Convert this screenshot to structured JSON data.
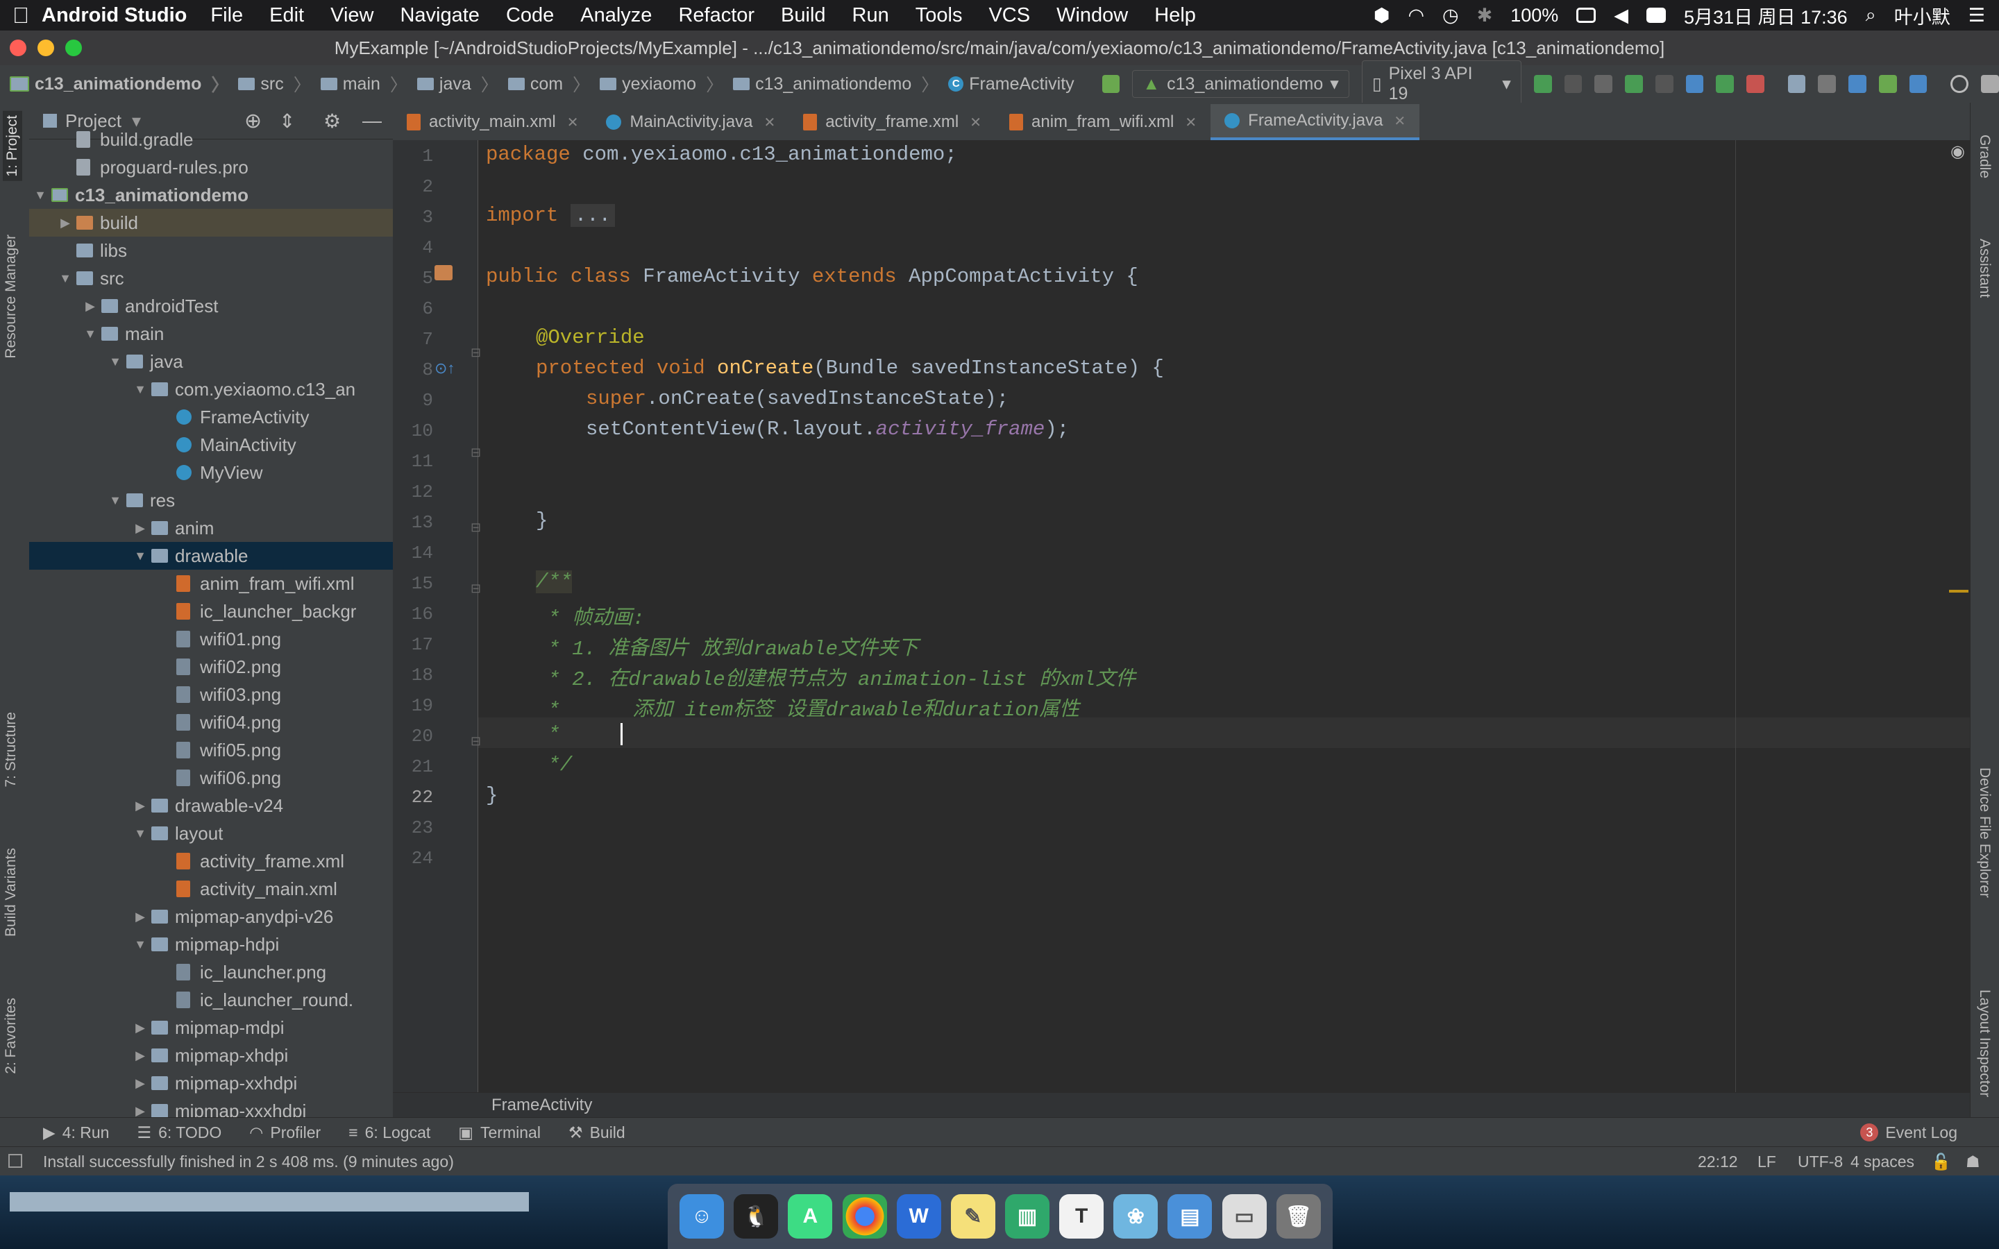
{
  "menubar": {
    "app": "Android Studio",
    "items": [
      "File",
      "Edit",
      "View",
      "Navigate",
      "Code",
      "Analyze",
      "Refactor",
      "Build",
      "Run",
      "Tools",
      "VCS",
      "Window",
      "Help"
    ],
    "battery": "100%",
    "datetime": "5月31日 周日 17:36",
    "user": "叶小默"
  },
  "window": {
    "title": "MyExample [~/AndroidStudioProjects/MyExample] - .../c13_animationdemo/src/main/java/com/yexiaomo/c13_animationdemo/FrameActivity.java [c13_animationdemo]"
  },
  "navbar": {
    "crumbs": [
      "c13_animationdemo",
      "src",
      "main",
      "java",
      "com",
      "yexiaomo",
      "c13_animationdemo",
      "FrameActivity"
    ],
    "run_config": "c13_animationdemo",
    "device": "Pixel 3 API 19"
  },
  "left_stripe": {
    "project": "1: Project",
    "resource_manager": "Resource Manager",
    "structure": "7: Structure",
    "build_variants": "Build Variants",
    "favorites": "2: Favorites"
  },
  "right_stripe": {
    "gradle": "Gradle",
    "assistant": "Assistant",
    "device_explorer": "Device File Explorer",
    "layout_inspector": "Layout Inspector"
  },
  "project_panel": {
    "title": "Project",
    "tree": [
      {
        "label": "build.gradle",
        "icon": "file"
      },
      {
        "label": "proguard-rules.pro",
        "icon": "file"
      },
      {
        "label": "c13_animationdemo",
        "icon": "mod",
        "arrow": "▼"
      },
      {
        "label": "build",
        "icon": "folder-o",
        "arrow": "▶"
      },
      {
        "label": "libs",
        "icon": "folder-c"
      },
      {
        "label": "src",
        "icon": "folder-c",
        "arrow": "▼"
      },
      {
        "label": "androidTest",
        "icon": "folder-c",
        "arrow": "▶"
      },
      {
        "label": "main",
        "icon": "folder-c",
        "arrow": "▼"
      },
      {
        "label": "java",
        "icon": "folder-c",
        "arrow": "▼"
      },
      {
        "label": "com.yexiaomo.c13_an",
        "icon": "pkg",
        "arrow": "▼"
      },
      {
        "label": "FrameActivity",
        "icon": "cls"
      },
      {
        "label": "MainActivity",
        "icon": "cls"
      },
      {
        "label": "MyView",
        "icon": "cls"
      },
      {
        "label": "res",
        "icon": "folder-c",
        "arrow": "▼"
      },
      {
        "label": "anim",
        "icon": "folder-c",
        "arrow": "▶"
      },
      {
        "label": "drawable",
        "icon": "folder-c",
        "arrow": "▼"
      },
      {
        "label": "anim_fram_wifi.xml",
        "icon": "xml"
      },
      {
        "label": "ic_launcher_backgr",
        "icon": "xml"
      },
      {
        "label": "wifi01.png",
        "icon": "png"
      },
      {
        "label": "wifi02.png",
        "icon": "png"
      },
      {
        "label": "wifi03.png",
        "icon": "png"
      },
      {
        "label": "wifi04.png",
        "icon": "png"
      },
      {
        "label": "wifi05.png",
        "icon": "png"
      },
      {
        "label": "wifi06.png",
        "icon": "png"
      },
      {
        "label": "drawable-v24",
        "icon": "folder-c",
        "arrow": "▶"
      },
      {
        "label": "layout",
        "icon": "folder-c",
        "arrow": "▼"
      },
      {
        "label": "activity_frame.xml",
        "icon": "xml"
      },
      {
        "label": "activity_main.xml",
        "icon": "xml"
      },
      {
        "label": "mipmap-anydpi-v26",
        "icon": "folder-c",
        "arrow": "▶"
      },
      {
        "label": "mipmap-hdpi",
        "icon": "folder-c",
        "arrow": "▼"
      },
      {
        "label": "ic_launcher.png",
        "icon": "png"
      },
      {
        "label": "ic_launcher_round.",
        "icon": "png"
      },
      {
        "label": "mipmap-mdpi",
        "icon": "folder-c",
        "arrow": "▶"
      },
      {
        "label": "mipmap-xhdpi",
        "icon": "folder-c",
        "arrow": "▶"
      },
      {
        "label": "mipmap-xxhdpi",
        "icon": "folder-c",
        "arrow": "▶"
      },
      {
        "label": "mipmap-xxxhdpi",
        "icon": "folder-c",
        "arrow": "▶"
      }
    ]
  },
  "tabs": [
    {
      "label": "activity_main.xml",
      "type": "xml"
    },
    {
      "label": "MainActivity.java",
      "type": "cls"
    },
    {
      "label": "activity_frame.xml",
      "type": "xml"
    },
    {
      "label": "anim_fram_wifi.xml",
      "type": "xml"
    },
    {
      "label": "FrameActivity.java",
      "type": "cls",
      "active": true
    }
  ],
  "editor": {
    "line_numbers": [
      "1",
      "2",
      "3",
      "4",
      "5",
      "6",
      "7",
      "8",
      "9",
      "10",
      "11",
      "12",
      "13",
      "14",
      "15",
      "16",
      "17",
      "18",
      "19",
      "20",
      "21",
      "22",
      "23",
      "24"
    ],
    "current_line": "22",
    "code": {
      "l1_kw": "package",
      "l1_rest": " com.yexiaomo.c13_animationdemo;",
      "l3_kw": "import",
      "l3_fold": "...",
      "l7_kw1": "public class",
      "l7_cls": " FrameActivity ",
      "l7_kw2": "extends",
      "l7_rest": " AppCompatActivity {",
      "l9_ann": "@Override",
      "l10_kw": "protected void",
      "l10_fn": "onCreate",
      "l10_rest": "(Bundle savedInstanceState) {",
      "l11_kw": "super",
      "l11_rest": ".onCreate(savedInstanceState);",
      "l12_a": "setContentView(R.layout.",
      "l12_fld": "activity_frame",
      "l12_b": ");",
      "l15": "}",
      "l17": "/**",
      "l18": " * 帧动画:",
      "l19": " * 1. 准备图片 放到drawable文件夹下",
      "l20": " * 2. 在drawable创建根节点为 animation-list 的xml文件",
      "l21": " *      添加 item标签 设置drawable和duration属性",
      "l22": " *     ",
      "l23": " */",
      "l24": "}"
    }
  },
  "breadcrumb_bottom": "FrameActivity",
  "bottom_tools": {
    "run": "4: Run",
    "todo": "6: TODO",
    "profiler": "Profiler",
    "logcat": "6: Logcat",
    "terminal": "Terminal",
    "build": "Build",
    "event_count": "3",
    "event_log": "Event Log"
  },
  "status": {
    "message": "Install successfully finished in 2 s 408 ms. (9 minutes ago)",
    "position": "22:12",
    "line_sep": "LF",
    "encoding": "UTF-8",
    "indent": "4 spaces"
  },
  "colors": {
    "accent": "#4a88c7",
    "selected_row": "#0d293e",
    "highlight_row": "#4e4a3c"
  }
}
